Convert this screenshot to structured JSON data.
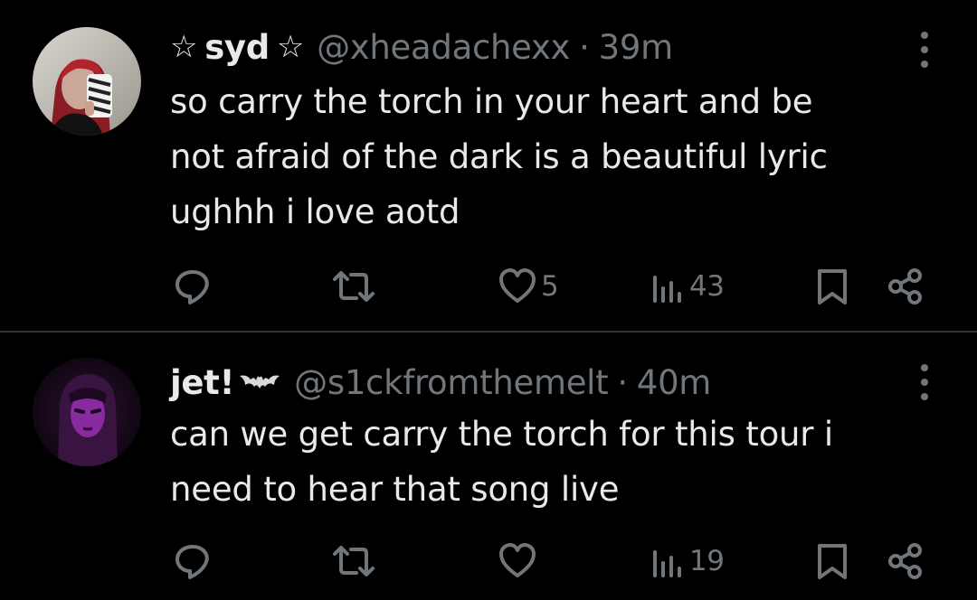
{
  "posts": [
    {
      "display_name_star_left": "☆",
      "display_name": "syd",
      "display_name_star_right": "☆",
      "handle": "@xheadachexx",
      "separator": "·",
      "time": "39m",
      "text_lines": [
        "so carry the torch in your heart and be",
        "not afraid of the dark is a beautiful lyric",
        "ughhh i love aotd"
      ],
      "likes": "5",
      "views": "43"
    },
    {
      "display_name": "jet!",
      "name_icon": "bat-icon",
      "handle": "@s1ckfromthemelt",
      "separator": "·",
      "time": "40m",
      "text_lines": [
        "can we get carry the torch for this tour i",
        "need to hear that song live"
      ],
      "likes": "",
      "views": "19"
    }
  ],
  "icons": {
    "reply": "reply-icon",
    "repost": "repost-icon",
    "like": "heart-icon",
    "views": "views-icon",
    "bookmark": "bookmark-icon",
    "share": "share-icon",
    "more": "more-vertical-icon"
  },
  "colors": {
    "background": "#000000",
    "text": "#e7e9ea",
    "secondary": "#71767b",
    "divider": "#2f3336"
  }
}
